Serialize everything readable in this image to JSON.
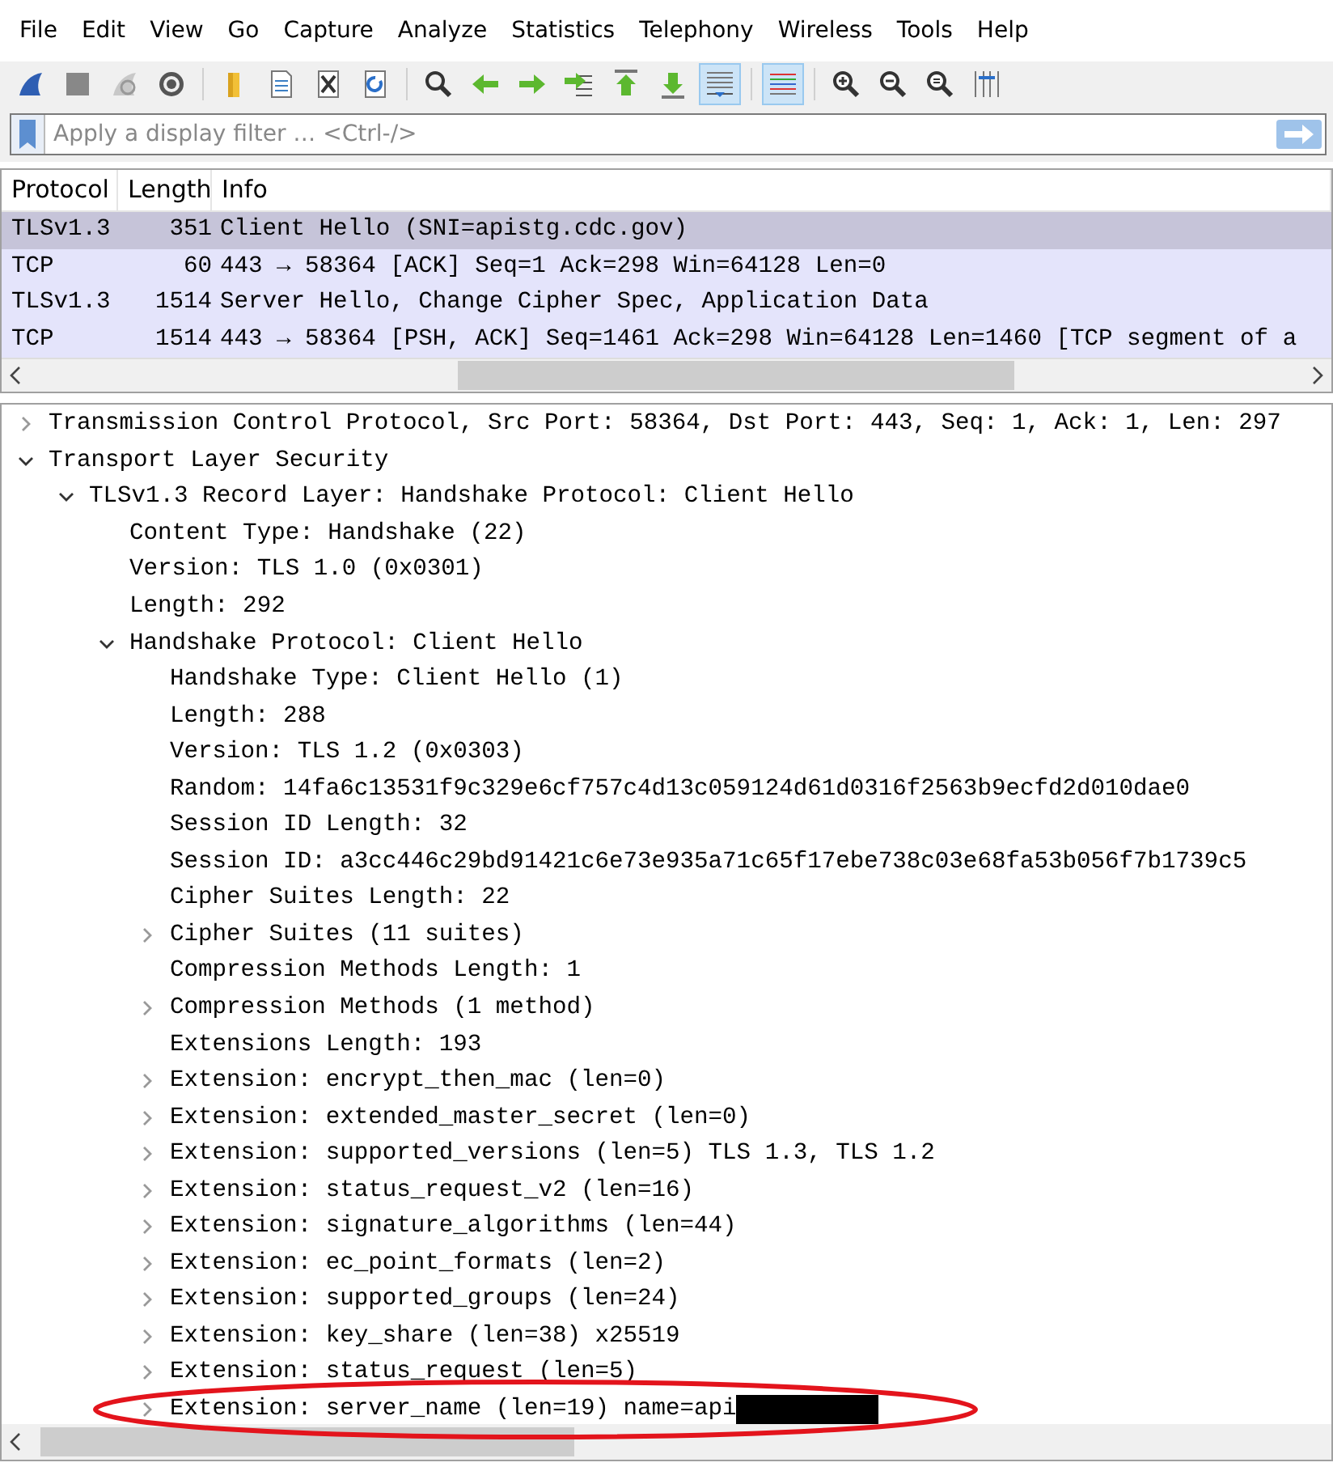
{
  "menu": [
    "File",
    "Edit",
    "View",
    "Go",
    "Capture",
    "Analyze",
    "Statistics",
    "Telephony",
    "Wireless",
    "Tools",
    "Help"
  ],
  "toolbar": [
    {
      "kind": "fin",
      "pressed": false
    },
    {
      "kind": "stop",
      "pressed": false
    },
    {
      "kind": "restart",
      "pressed": false
    },
    {
      "kind": "gear",
      "pressed": false
    },
    {
      "kind": "sep"
    },
    {
      "kind": "folder",
      "pressed": false
    },
    {
      "kind": "file",
      "pressed": false
    },
    {
      "kind": "close",
      "pressed": false
    },
    {
      "kind": "reload",
      "pressed": false
    },
    {
      "kind": "sep"
    },
    {
      "kind": "find",
      "pressed": false
    },
    {
      "kind": "back",
      "pressed": false
    },
    {
      "kind": "forward",
      "pressed": false
    },
    {
      "kind": "goto",
      "pressed": false
    },
    {
      "kind": "first",
      "pressed": false
    },
    {
      "kind": "last",
      "pressed": false
    },
    {
      "kind": "autoscroll",
      "pressed": true
    },
    {
      "kind": "sep"
    },
    {
      "kind": "colorize",
      "pressed": true
    },
    {
      "kind": "sep"
    },
    {
      "kind": "zoomin",
      "pressed": false
    },
    {
      "kind": "zoomout",
      "pressed": false
    },
    {
      "kind": "zoomreset",
      "pressed": false
    },
    {
      "kind": "resize",
      "pressed": false
    }
  ],
  "filter": {
    "placeholder": "Apply a display filter … <Ctrl-/>"
  },
  "packet_list": {
    "columns": [
      "Protocol",
      "Length",
      "Info"
    ],
    "rows": [
      {
        "protocol": "TLSv1.3",
        "length": "351",
        "info": "Client Hello (SNI=apistg.cdc.gov)",
        "selected": true
      },
      {
        "protocol": "TCP",
        "length": "60",
        "info": "443 → 58364 [ACK] Seq=1 Ack=298 Win=64128 Len=0",
        "selected": false
      },
      {
        "protocol": "TLSv1.3",
        "length": "1514",
        "info": "Server Hello, Change Cipher Spec, Application Data",
        "selected": false
      },
      {
        "protocol": "TCP",
        "length": "1514",
        "info": "443 → 58364 [PSH, ACK] Seq=1461 Ack=298 Win=64128 Len=1460 [TCP segment of a",
        "selected": false
      }
    ]
  },
  "details": [
    {
      "text": "Transmission Control Protocol, Src Port: 58364, Dst Port: 443, Seq: 1, Ack: 1, Len: 297",
      "expanded": false
    },
    {
      "text": "Transport Layer Security",
      "expanded": true,
      "children": [
        {
          "text": "TLSv1.3 Record Layer: Handshake Protocol: Client Hello",
          "expanded": true,
          "children": [
            {
              "text": "Content Type: Handshake (22)"
            },
            {
              "text": "Version: TLS 1.0 (0x0301)"
            },
            {
              "text": "Length: 292"
            },
            {
              "text": "Handshake Protocol: Client Hello",
              "expanded": true,
              "children": [
                {
                  "text": "Handshake Type: Client Hello (1)"
                },
                {
                  "text": "Length: 288"
                },
                {
                  "text": "Version: TLS 1.2 (0x0303)"
                },
                {
                  "text": "Random: 14fa6c13531f9c329e6cf757c4d13c059124d61d0316f2563b9ecfd2d010dae0"
                },
                {
                  "text": "Session ID Length: 32"
                },
                {
                  "text": "Session ID: a3cc446c29bd91421c6e73e935a71c65f17ebe738c03e68fa53b056f7b1739c5"
                },
                {
                  "text": "Cipher Suites Length: 22"
                },
                {
                  "text": "Cipher Suites (11 suites)",
                  "expanded": false
                },
                {
                  "text": "Compression Methods Length: 1"
                },
                {
                  "text": "Compression Methods (1 method)",
                  "expanded": false
                },
                {
                  "text": "Extensions Length: 193"
                },
                {
                  "text": "Extension: encrypt_then_mac (len=0)",
                  "expanded": false
                },
                {
                  "text": "Extension: extended_master_secret (len=0)",
                  "expanded": false
                },
                {
                  "text": "Extension: supported_versions (len=5) TLS 1.3, TLS 1.2",
                  "expanded": false
                },
                {
                  "text": "Extension: status_request_v2 (len=16)",
                  "expanded": false
                },
                {
                  "text": "Extension: signature_algorithms (len=44)",
                  "expanded": false
                },
                {
                  "text": "Extension: ec_point_formats (len=2)",
                  "expanded": false
                },
                {
                  "text": "Extension: supported_groups (len=24)",
                  "expanded": false
                },
                {
                  "text": "Extension: key_share (len=38) x25519",
                  "expanded": false
                },
                {
                  "text": "Extension: status_request (len=5)",
                  "expanded": false
                },
                {
                  "text": "Extension: server_name (len=19) name=api",
                  "expanded": false,
                  "redacted": true,
                  "annotated": true
                }
              ]
            }
          ]
        }
      ]
    }
  ]
}
